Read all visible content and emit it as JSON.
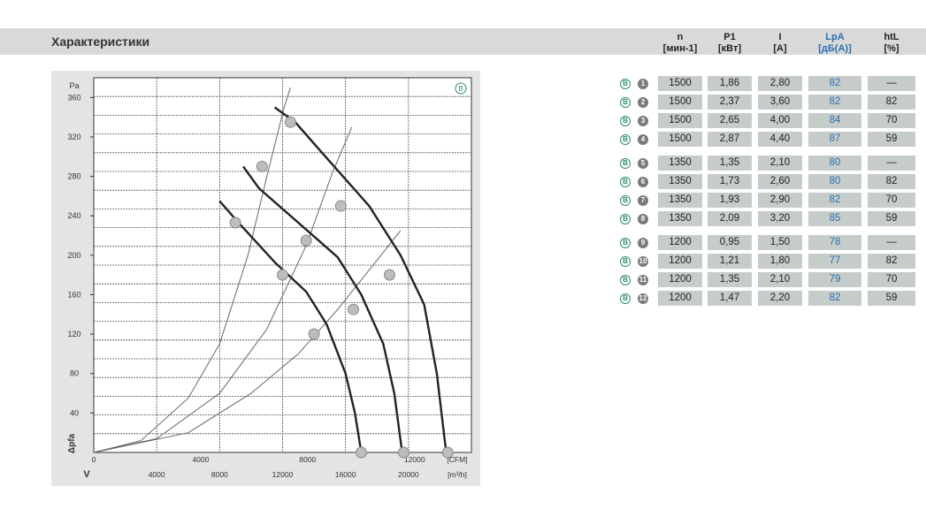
{
  "section": {
    "title": "Характеристики"
  },
  "table": {
    "headers": [
      {
        "key": "n",
        "label": "n",
        "unit": "[мин-1]",
        "color": "#222222"
      },
      {
        "key": "p1",
        "label": "P1",
        "unit": "[кВт]",
        "color": "#222222"
      },
      {
        "key": "i",
        "label": "I",
        "unit": "[A]",
        "color": "#222222"
      },
      {
        "key": "lpa",
        "label": "LpA",
        "unit": "[дБ(A)]",
        "color": "#2a6fb0"
      },
      {
        "key": "h",
        "label": "htL",
        "unit": "[%]",
        "color": "#222222"
      }
    ],
    "badge_letter": "B",
    "rows": [
      {
        "no": "1",
        "n": "1500",
        "p1": "1,86",
        "i": "2,80",
        "lpa": "82",
        "h": "—"
      },
      {
        "no": "2",
        "n": "1500",
        "p1": "2,37",
        "i": "3,60",
        "lpa": "82",
        "h": "82"
      },
      {
        "no": "3",
        "n": "1500",
        "p1": "2,65",
        "i": "4,00",
        "lpa": "84",
        "h": "70"
      },
      {
        "no": "4",
        "n": "1500",
        "p1": "2,87",
        "i": "4,40",
        "lpa": "87",
        "h": "59"
      },
      {
        "no": "5",
        "n": "1350",
        "p1": "1,35",
        "i": "2,10",
        "lpa": "80",
        "h": "—"
      },
      {
        "no": "6",
        "n": "1350",
        "p1": "1,73",
        "i": "2,60",
        "lpa": "80",
        "h": "82"
      },
      {
        "no": "7",
        "n": "1350",
        "p1": "1,93",
        "i": "2,90",
        "lpa": "82",
        "h": "70"
      },
      {
        "no": "8",
        "n": "1350",
        "p1": "2,09",
        "i": "3,20",
        "lpa": "85",
        "h": "59"
      },
      {
        "no": "9",
        "n": "1200",
        "p1": "0,95",
        "i": "1,50",
        "lpa": "78",
        "h": "—"
      },
      {
        "no": "10",
        "n": "1200",
        "p1": "1,21",
        "i": "1,80",
        "lpa": "77",
        "h": "82"
      },
      {
        "no": "11",
        "n": "1200",
        "p1": "1,35",
        "i": "2,10",
        "lpa": "79",
        "h": "70"
      },
      {
        "no": "12",
        "n": "1200",
        "p1": "1,47",
        "i": "2,20",
        "lpa": "82",
        "h": "59"
      }
    ]
  },
  "chart_data": {
    "type": "line",
    "title": "",
    "badge": "B",
    "xlabel": "V",
    "ylabel": "Δpfa",
    "x_units": [
      "[CFM]",
      "[m³/h]"
    ],
    "x_cfm_ticks": [
      "0",
      "4000",
      "8000",
      "12000"
    ],
    "x_m3h_ticks": [
      "4000",
      "8000",
      "12000",
      "16000",
      "20000"
    ],
    "y_pa_ticks": [
      "40",
      "80",
      "120",
      "160",
      "200",
      "240",
      "280",
      "320",
      "360"
    ],
    "y_label_top": "Pa",
    "xlim": [
      0,
      24000
    ],
    "ylim": [
      0,
      380
    ],
    "fan_curves": [
      {
        "name": "1500",
        "points": [
          [
            11500,
            350
          ],
          [
            12800,
            335
          ],
          [
            15000,
            295
          ],
          [
            17500,
            250
          ],
          [
            19500,
            200
          ],
          [
            21000,
            150
          ],
          [
            21800,
            80
          ],
          [
            22400,
            0
          ]
        ]
      },
      {
        "name": "1350",
        "points": [
          [
            9500,
            290
          ],
          [
            10500,
            268
          ],
          [
            13000,
            233
          ],
          [
            15500,
            198
          ],
          [
            17000,
            160
          ],
          [
            18400,
            110
          ],
          [
            19100,
            60
          ],
          [
            19600,
            0
          ]
        ]
      },
      {
        "name": "1200",
        "points": [
          [
            8000,
            255
          ],
          [
            9200,
            233
          ],
          [
            11500,
            193
          ],
          [
            13500,
            163
          ],
          [
            14800,
            130
          ],
          [
            16000,
            80
          ],
          [
            16600,
            40
          ],
          [
            17000,
            0
          ]
        ]
      }
    ],
    "system_curves": [
      {
        "name": "a",
        "points": [
          [
            0,
            0
          ],
          [
            3000,
            12
          ],
          [
            6000,
            55
          ],
          [
            8000,
            110
          ],
          [
            9800,
            200
          ],
          [
            11000,
            280
          ],
          [
            12100,
            350
          ],
          [
            12500,
            370
          ]
        ]
      },
      {
        "name": "b",
        "points": [
          [
            0,
            0
          ],
          [
            4000,
            14
          ],
          [
            8000,
            60
          ],
          [
            11000,
            125
          ],
          [
            13500,
            210
          ],
          [
            15200,
            285
          ],
          [
            16400,
            330
          ]
        ]
      },
      {
        "name": "c",
        "points": [
          [
            0,
            0
          ],
          [
            6000,
            20
          ],
          [
            10000,
            60
          ],
          [
            13000,
            100
          ],
          [
            15500,
            145
          ],
          [
            17500,
            185
          ],
          [
            19500,
            225
          ]
        ]
      }
    ],
    "operating_points": [
      {
        "no": "1",
        "x": 12500,
        "y": 335
      },
      {
        "no": "2",
        "x": 15700,
        "y": 250
      },
      {
        "no": "3",
        "x": 18800,
        "y": 180
      },
      {
        "no": "4",
        "x": 22500,
        "y": 0
      },
      {
        "no": "5",
        "x": 10700,
        "y": 290
      },
      {
        "no": "6",
        "x": 13500,
        "y": 215
      },
      {
        "no": "7",
        "x": 16500,
        "y": 145
      },
      {
        "no": "8",
        "x": 19700,
        "y": 0
      },
      {
        "no": "9",
        "x": 9000,
        "y": 233
      },
      {
        "no": "10",
        "x": 12000,
        "y": 180
      },
      {
        "no": "11",
        "x": 14000,
        "y": 120
      },
      {
        "no": "12",
        "x": 17000,
        "y": 0
      }
    ],
    "grid": true,
    "colors": {
      "curve": "#222222",
      "system": "#666666",
      "grid": "#555555",
      "marker": "#bdbdbd",
      "badge": "#2e8b6e"
    }
  }
}
